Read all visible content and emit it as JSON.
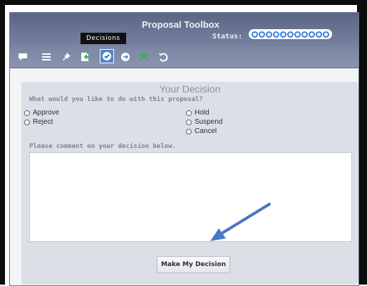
{
  "window": {
    "title": "Proposal Toolbox",
    "status_label": "Status:",
    "status_dot_count": 11
  },
  "toolbar": {
    "tooltip": "Decisions",
    "icons": [
      "comment-icon",
      "list-icon",
      "pin-icon",
      "add-document-icon",
      "check-icon",
      "arrow-right-icon",
      "shuffle-icon",
      "undo-icon"
    ],
    "active_icon": "check-icon"
  },
  "panel": {
    "heading": "Your Decision",
    "question": "What would you like to do with this proposal?",
    "options_left": [
      "Approve",
      "Reject"
    ],
    "options_right": [
      "Hold",
      "Suspend",
      "Cancel"
    ],
    "comment_label": "Please comment on your decision below.",
    "comment_value": "",
    "submit_label": "Make My Decision"
  },
  "colors": {
    "accent_arrow": "#4a78c4",
    "titlebar": "#626d8c",
    "status_dot": "#3b7fd9"
  }
}
